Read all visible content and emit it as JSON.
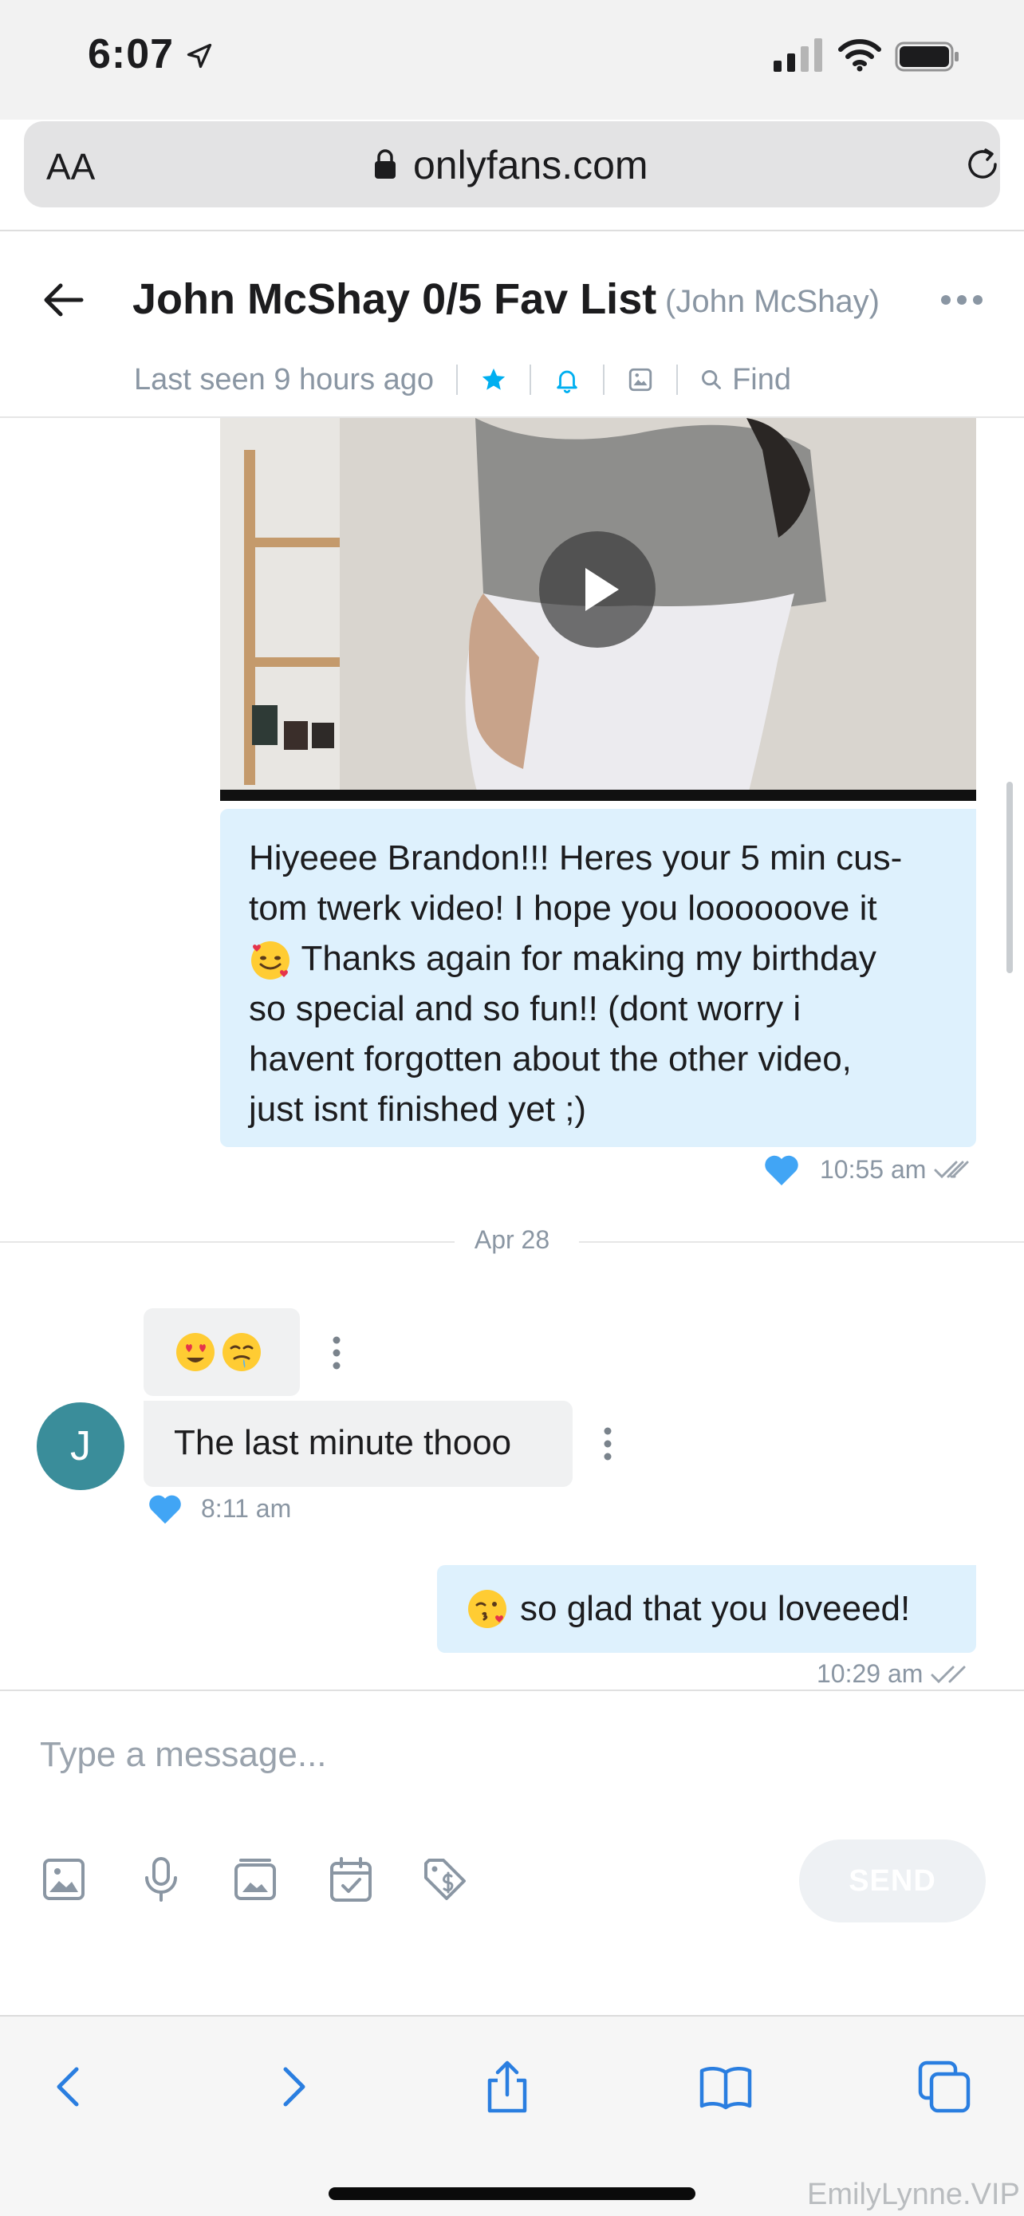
{
  "status_bar": {
    "time": "6:07"
  },
  "browser": {
    "aa_label": "AA",
    "url": "onlyfans.com"
  },
  "chat": {
    "title": "John McShay 0/5 Fav List",
    "username": "(John McShay)",
    "last_seen": "Last seen 9 hours ago",
    "find_label": "Find"
  },
  "messages": [
    {
      "direction": "sent",
      "type": "video+text",
      "text": "Hiyeeee Brandon!!! Heres your 5 min custom twerk video! I hope you looooove it 🥰 Thanks again for making my birthday so special and so fun!! (dont worry i havent forgotten about the other video, just isnt finished yet ;)",
      "text_lines": [
        "Hiyeeee Brandon!!! Heres your 5 min cus-",
        "tom twerk video! I hope you loooooove it",
        "Thanks again for making my birthday",
        "so special and so fun!! (dont worry i",
        "havent forgotten about the other video,",
        "just isnt finished yet ;)"
      ],
      "time": "10:55 am",
      "liked": true
    },
    {
      "direction": "received",
      "type": "emoji",
      "emoji_names": [
        "heart-eyes-face",
        "drooling-face"
      ]
    },
    {
      "direction": "received",
      "type": "text",
      "text": "The last minute thooo",
      "avatar_initial": "J",
      "time": "8:11 am",
      "liked": true
    },
    {
      "direction": "sent",
      "type": "text",
      "text": "so glad that you loveeed!",
      "emoji_name": "kissing-heart-face",
      "time": "10:29 am"
    }
  ],
  "date_divider": "Apr 28",
  "composer": {
    "placeholder": "Type a message...",
    "send_label": "SEND",
    "tools": [
      "image-icon",
      "microphone-icon",
      "vault-icon",
      "schedule-icon",
      "price-tag-icon"
    ]
  },
  "watermark": "EmilyLynne.VIP",
  "colors": {
    "accent_blue": "#00aff0",
    "sent_bubble": "#def1fd",
    "received_bubble": "#f0f1f2",
    "muted_text": "#8a96a3",
    "avatar": "#3a8d9a",
    "ios_link": "#2a7ee0"
  }
}
